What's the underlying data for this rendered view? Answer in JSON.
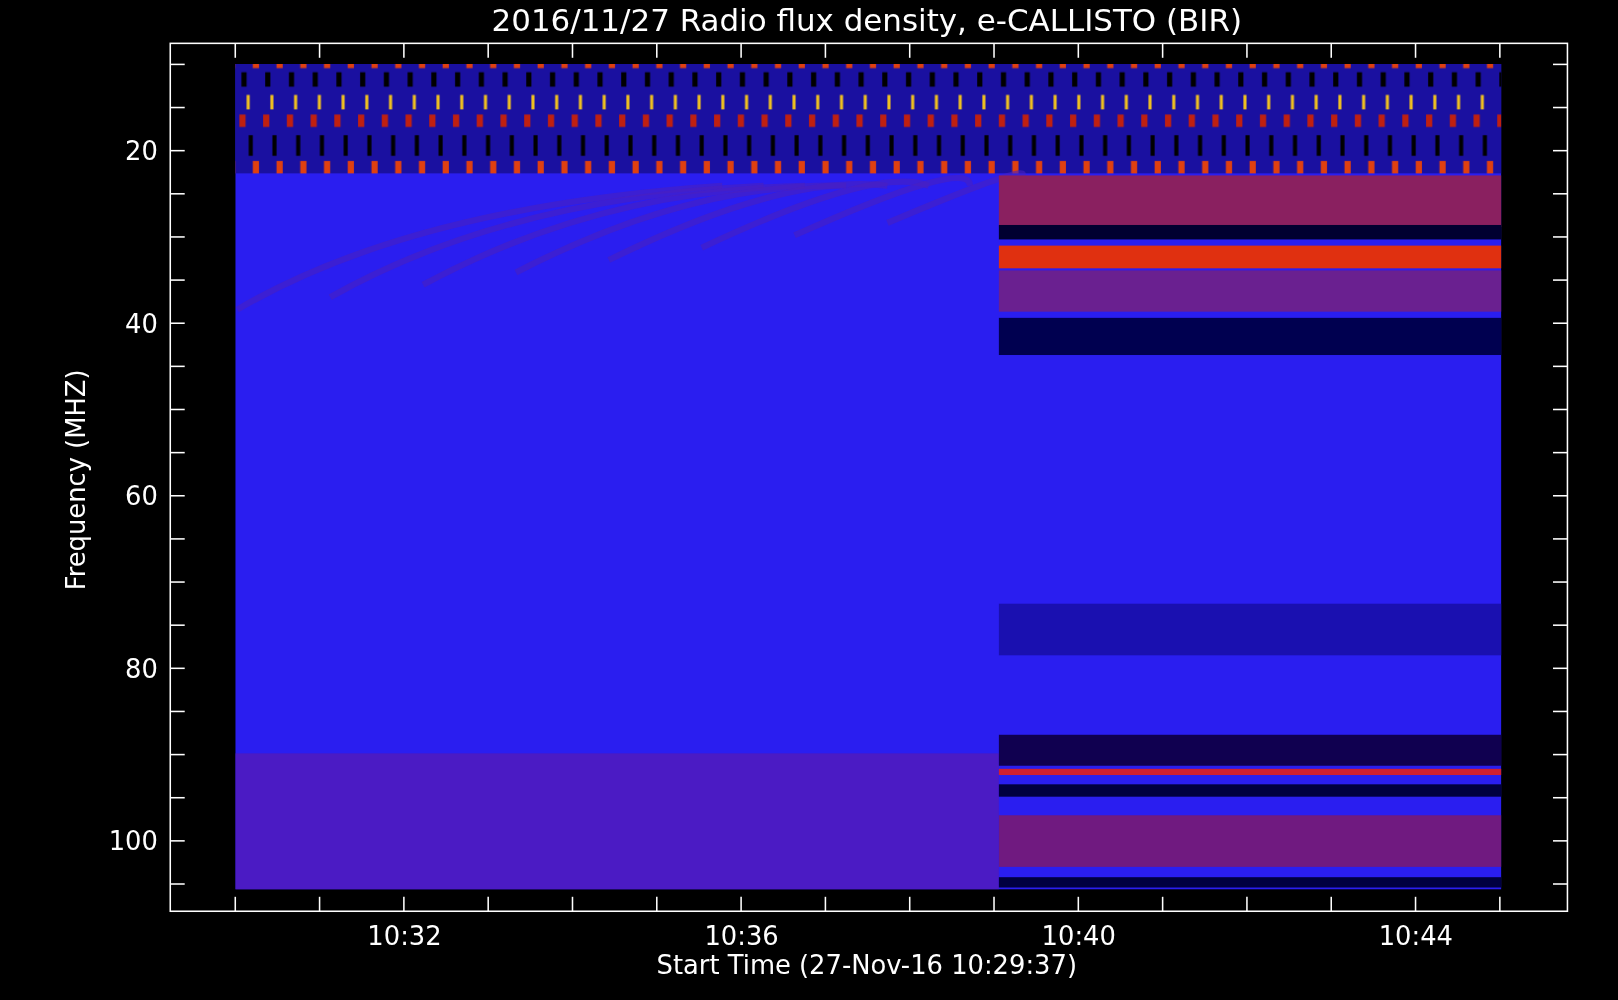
{
  "plot": {
    "title": "2016/11/27  Radio flux density, e-CALLISTO (BIR)",
    "x_axis": {
      "label": "Start Time (27-Nov-16 10:29:37)",
      "ticks": [
        "10:32",
        "10:36",
        "10:40",
        "10:44"
      ]
    },
    "y_axis": {
      "label": "Frequency (MHZ)",
      "ticks": [
        "20",
        "40",
        "60",
        "80",
        "100"
      ]
    }
  }
}
